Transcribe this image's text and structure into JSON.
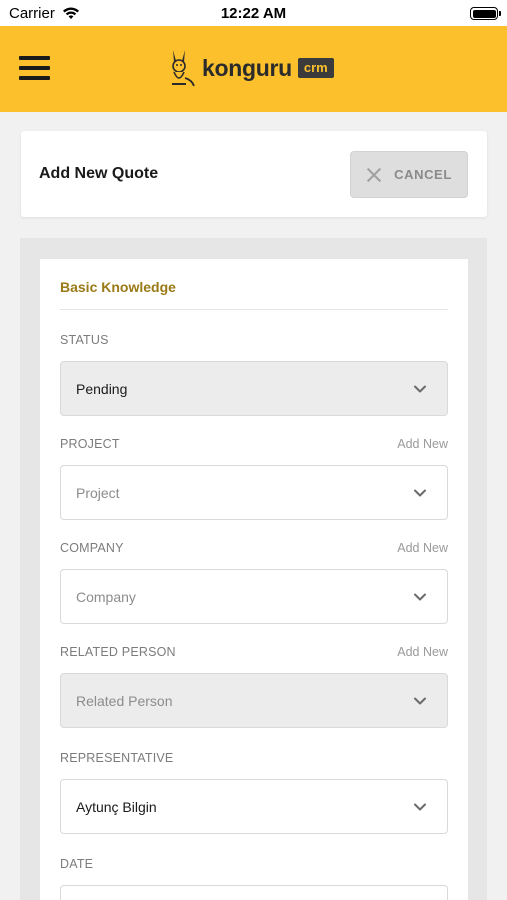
{
  "status_bar": {
    "carrier": "Carrier",
    "time": "12:22 AM"
  },
  "header": {
    "brand": "konguru",
    "badge": "crm"
  },
  "title_card": {
    "title": "Add New Quote",
    "cancel_label": "CANCEL"
  },
  "form": {
    "section_title": "Basic Knowledge",
    "status": {
      "label": "STATUS",
      "value": "Pending"
    },
    "project": {
      "label": "PROJECT",
      "add_new": "Add New",
      "placeholder": "Project"
    },
    "company": {
      "label": "COMPANY",
      "add_new": "Add New",
      "placeholder": "Company"
    },
    "related_person": {
      "label": "RELATED PERSON",
      "add_new": "Add New",
      "placeholder": "Related Person"
    },
    "representative": {
      "label": "REPRESENTATIVE",
      "value": "Aytunç Bilgin"
    },
    "date": {
      "label": "DATE"
    }
  },
  "colors": {
    "header_bg": "#fcc02c",
    "section_title": "#9a7a17",
    "badge_bg": "#3b3b3b"
  },
  "icons": [
    "wifi-icon",
    "battery-icon",
    "hamburger-menu-icon",
    "kangaroo-logo-icon",
    "close-icon",
    "chevron-down-icon"
  ]
}
